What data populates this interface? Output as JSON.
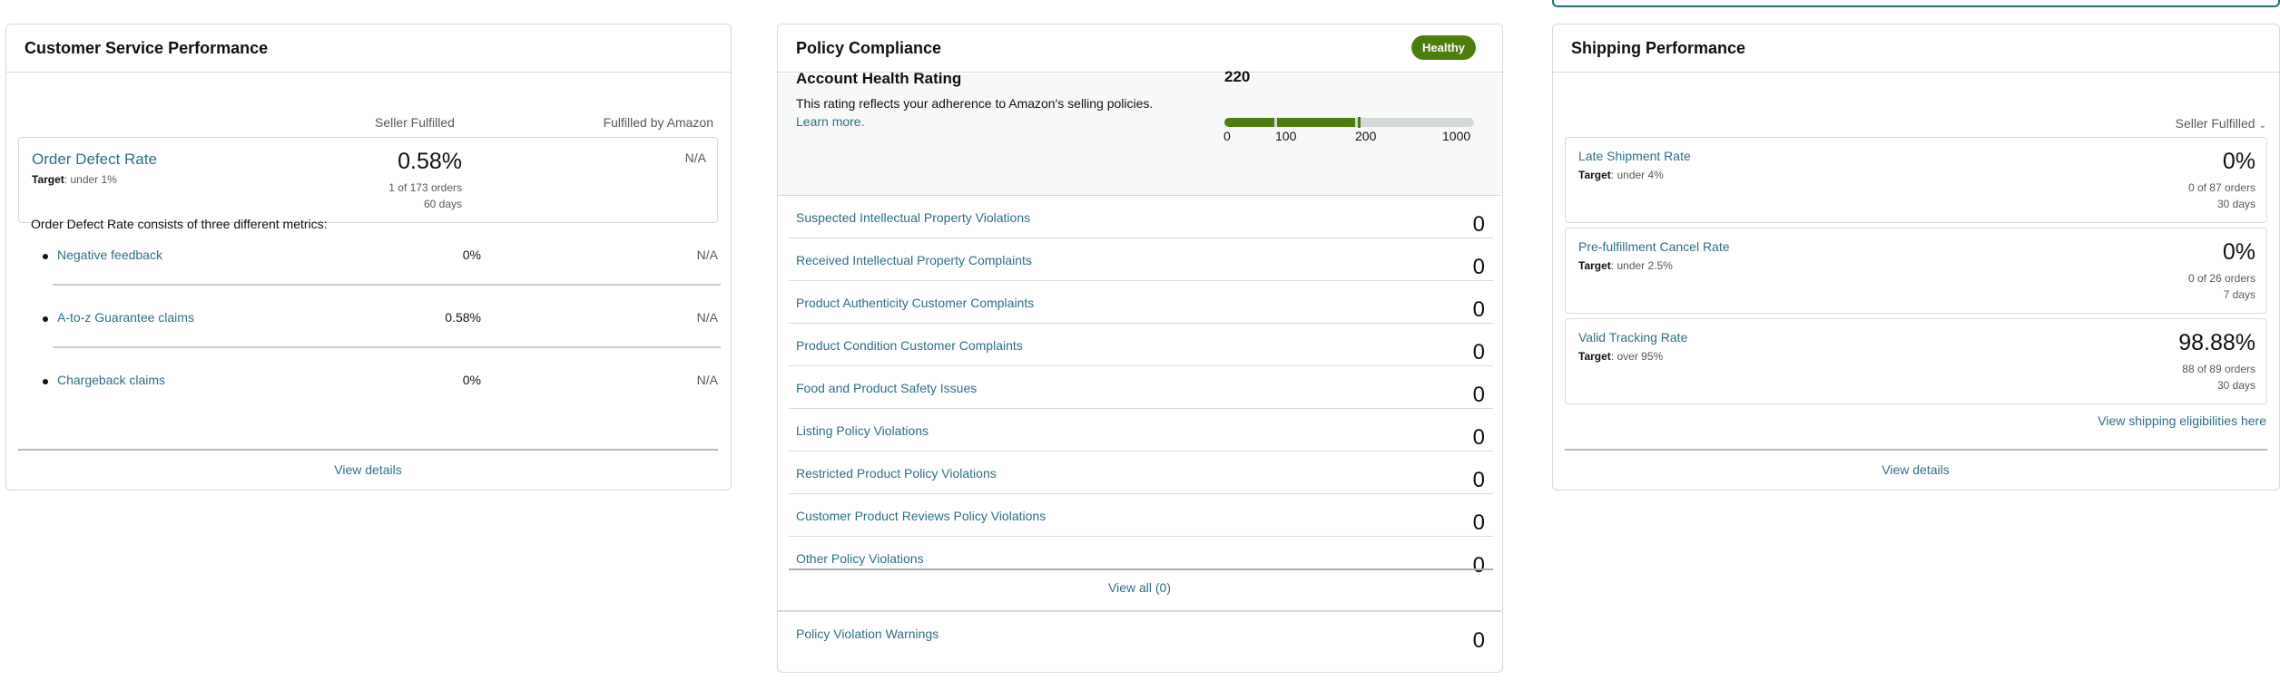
{
  "customer_service": {
    "title": "Customer Service Performance",
    "col_seller": "Seller Fulfilled",
    "col_amazon": "Fulfilled by Amazon",
    "odr": {
      "title": "Order Defect Rate",
      "target_label": "Target",
      "target_value": ": under 1%",
      "value": "0.58%",
      "orders": "1 of 173 orders",
      "days": "60 days",
      "amazon_value": "N/A"
    },
    "description": "Order Defect Rate consists of three different metrics:",
    "metrics": [
      {
        "name": "Negative feedback",
        "seller": "0%",
        "amazon": "N/A"
      },
      {
        "name": "A-to-z Guarantee claims",
        "seller": "0.58%",
        "amazon": "N/A"
      },
      {
        "name": "Chargeback claims",
        "seller": "0%",
        "amazon": "N/A"
      }
    ],
    "view_details": "View details"
  },
  "policy_compliance": {
    "title": "Policy Compliance",
    "badge": "Healthy",
    "badge_color": "#4d7c0f",
    "ahr": {
      "title": "Account Health Rating",
      "description": "This rating reflects your adherence to Amazon's selling policies.",
      "learn_more": "Learn more.",
      "value": "220",
      "ticks": [
        "0",
        "100",
        "200",
        "1000"
      ],
      "rating_level": 220,
      "scale_max": 1000
    },
    "rows": [
      {
        "name": "Suspected Intellectual Property Violations",
        "count": "0"
      },
      {
        "name": "Received Intellectual Property Complaints",
        "count": "0"
      },
      {
        "name": "Product Authenticity Customer Complaints",
        "count": "0"
      },
      {
        "name": "Product Condition Customer Complaints",
        "count": "0"
      },
      {
        "name": "Food and Product Safety Issues",
        "count": "0"
      },
      {
        "name": "Listing Policy Violations",
        "count": "0"
      },
      {
        "name": "Restricted Product Policy Violations",
        "count": "0"
      },
      {
        "name": "Customer Product Reviews Policy Violations",
        "count": "0"
      },
      {
        "name": "Other Policy Violations",
        "count": "0"
      }
    ],
    "view_all": "View all (0)",
    "warnings": {
      "name": "Policy Violation Warnings",
      "count": "0"
    }
  },
  "shipping": {
    "title": "Shipping Performance",
    "select_label": "Seller Fulfilled",
    "metrics": [
      {
        "name": "Late Shipment Rate",
        "target_label": "Target",
        "target_value": ": under 4%",
        "value": "0%",
        "orders": "0 of 87 orders",
        "days": "30 days"
      },
      {
        "name": "Pre-fulfillment Cancel Rate",
        "target_label": "Target",
        "target_value": ": under 2.5%",
        "value": "0%",
        "orders": "0 of 26 orders",
        "days": "7 days"
      },
      {
        "name": "Valid Tracking Rate",
        "target_label": "Target",
        "target_value": ": over 95%",
        "value": "98.88%",
        "orders": "88 of 89 orders",
        "days": "30 days"
      }
    ],
    "eligibility_link": "View shipping eligibilities here",
    "view_details": "View details"
  }
}
